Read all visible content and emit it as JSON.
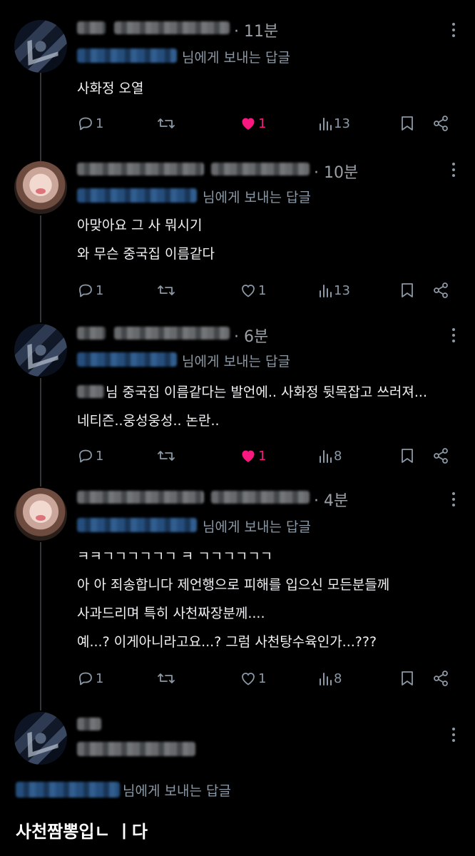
{
  "reply_suffix": "님에게 보내는 답글",
  "tweets": [
    {
      "time": "· 11분",
      "lines": [
        "사화정 오열"
      ],
      "reply_count": "1",
      "like_count": "1",
      "view_count": "13",
      "liked": true
    },
    {
      "time": "· 10분",
      "lines": [
        "아맞아요 그 사 뭐시기",
        "와 무슨 중국집 이름같다"
      ],
      "reply_count": "1",
      "like_count": "1",
      "view_count": "13",
      "liked": false
    },
    {
      "time": "· 6분",
      "lines": [
        "님 중국집 이름같다는 발언에.. 사화정 뒷목잡고 쓰러져...",
        "네티즌..웅성웅성.. 논란.."
      ],
      "reply_count": "1",
      "like_count": "1",
      "view_count": "8",
      "liked": true
    },
    {
      "time": "· 4분",
      "lines": [
        "ㅋㅋㄱㄱㄱㄱㄱㄱ ㅋ ㄱㄱㄱㄱㄱㄱ",
        "아 아 죄송합니다 제언행으로 피해를 입으신 모든분들께",
        "사과드리며 특히 사천짜장분께....",
        "예...? 이게아니라고요...? 그럼 사천탕수육인가...???"
      ],
      "reply_count": "1",
      "like_count": "1",
      "view_count": "8",
      "liked": false
    }
  ],
  "last_tweet": {
    "body": "사천짬뽕입ㄴ ㅣ다"
  },
  "colors": {
    "like_active": "#f91880",
    "icon": "#8b98a5",
    "background": "#000000"
  }
}
